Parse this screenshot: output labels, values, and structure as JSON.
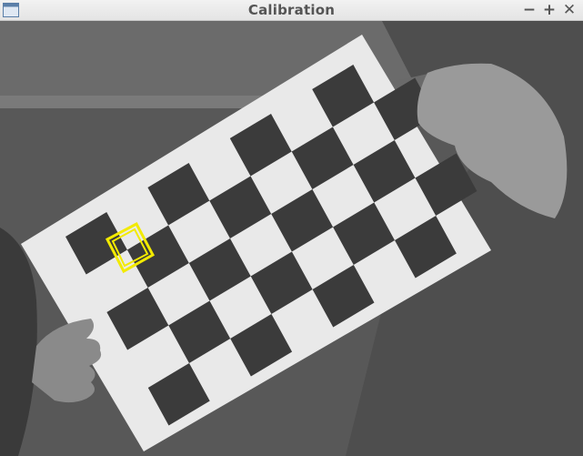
{
  "window": {
    "title": "Calibration",
    "icon": "window-app-icon",
    "controls": {
      "minimize": "−",
      "maximize": "+",
      "close": "✕"
    }
  },
  "camera_view": {
    "mode": "grayscale",
    "overlay_color": "#f2ea00"
  },
  "calibration_board": {
    "pattern": "checkerboard",
    "board_color": "#e9e9e9",
    "square_color": "#3b3b3b",
    "detected_corner_highlight": {
      "color": "#f2ea00"
    }
  }
}
